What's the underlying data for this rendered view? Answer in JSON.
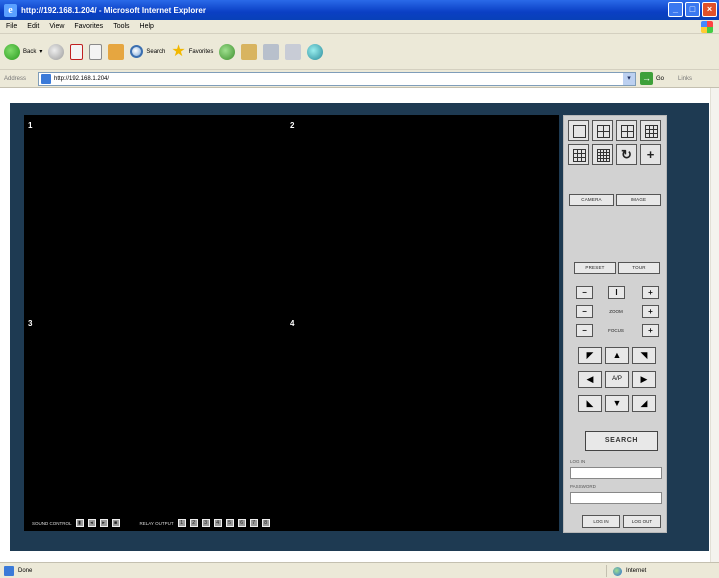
{
  "window": {
    "title": "http://192.168.1.204/ - Microsoft Internet Explorer",
    "logo_glyph": "e",
    "buttons": {
      "minimize": "_",
      "maximize": "□",
      "close": "×"
    }
  },
  "menu": [
    "File",
    "Edit",
    "View",
    "Favorites",
    "Tools",
    "Help"
  ],
  "toolbar": {
    "back_label": "Back",
    "dropdown_glyph": "▾",
    "search_label": "Search",
    "favorites_label": "Favorites",
    "star_glyph": "★"
  },
  "address": {
    "label": "Address",
    "url": "http://192.168.1.204/",
    "dropdown_glyph": "▾",
    "go_glyph": "→",
    "go_label": "Go",
    "links_label": "Links"
  },
  "video": {
    "cells": [
      "1",
      "2",
      "3",
      "4"
    ]
  },
  "bottom_bar": {
    "sound_label": "SOUND CONTROL",
    "sound_buttons": [
      "▮",
      "◂",
      "▸",
      "■"
    ],
    "relay_label": "RELAY OUTPUT",
    "relay_buttons": [
      "1",
      "2",
      "3",
      "4",
      "5",
      "6",
      "7",
      "8"
    ]
  },
  "panel": {
    "layout_buttons": [
      {
        "icon": "single-view-icon"
      },
      {
        "icon": "quad-view-icon"
      },
      {
        "icon": "quad-view-icon"
      },
      {
        "icon": "nine-view-icon"
      },
      {
        "icon": "nine-view-icon"
      },
      {
        "icon": "sixteen-view-icon"
      },
      {
        "icon": "sequence-icon",
        "glyph": "↻"
      },
      {
        "icon": "plus-icon",
        "glyph": "+"
      }
    ],
    "camera_tab": "CAMERA",
    "image_tab": "IMAGE",
    "preset_tab": "PRESET",
    "tour_tab": "TOUR",
    "zoom_label": "ZOOM",
    "focus_label": "FOCUS",
    "minus_glyph": "−",
    "plus_glyph": "+",
    "stop_glyph": "I",
    "directions": {
      "up_left": "◤",
      "up": "▲",
      "up_right": "◥",
      "left": "◀",
      "auto": "A/P",
      "right": "▶",
      "down_left": "◣",
      "down": "▼",
      "down_right": "◢"
    },
    "search_label": "SEARCH",
    "login_label": "LOG IN",
    "password_label": "PASSWORD",
    "login_button": "LOG IN",
    "logout_button": "LOG OUT"
  },
  "status": {
    "text": "Done",
    "zone": "Internet"
  }
}
